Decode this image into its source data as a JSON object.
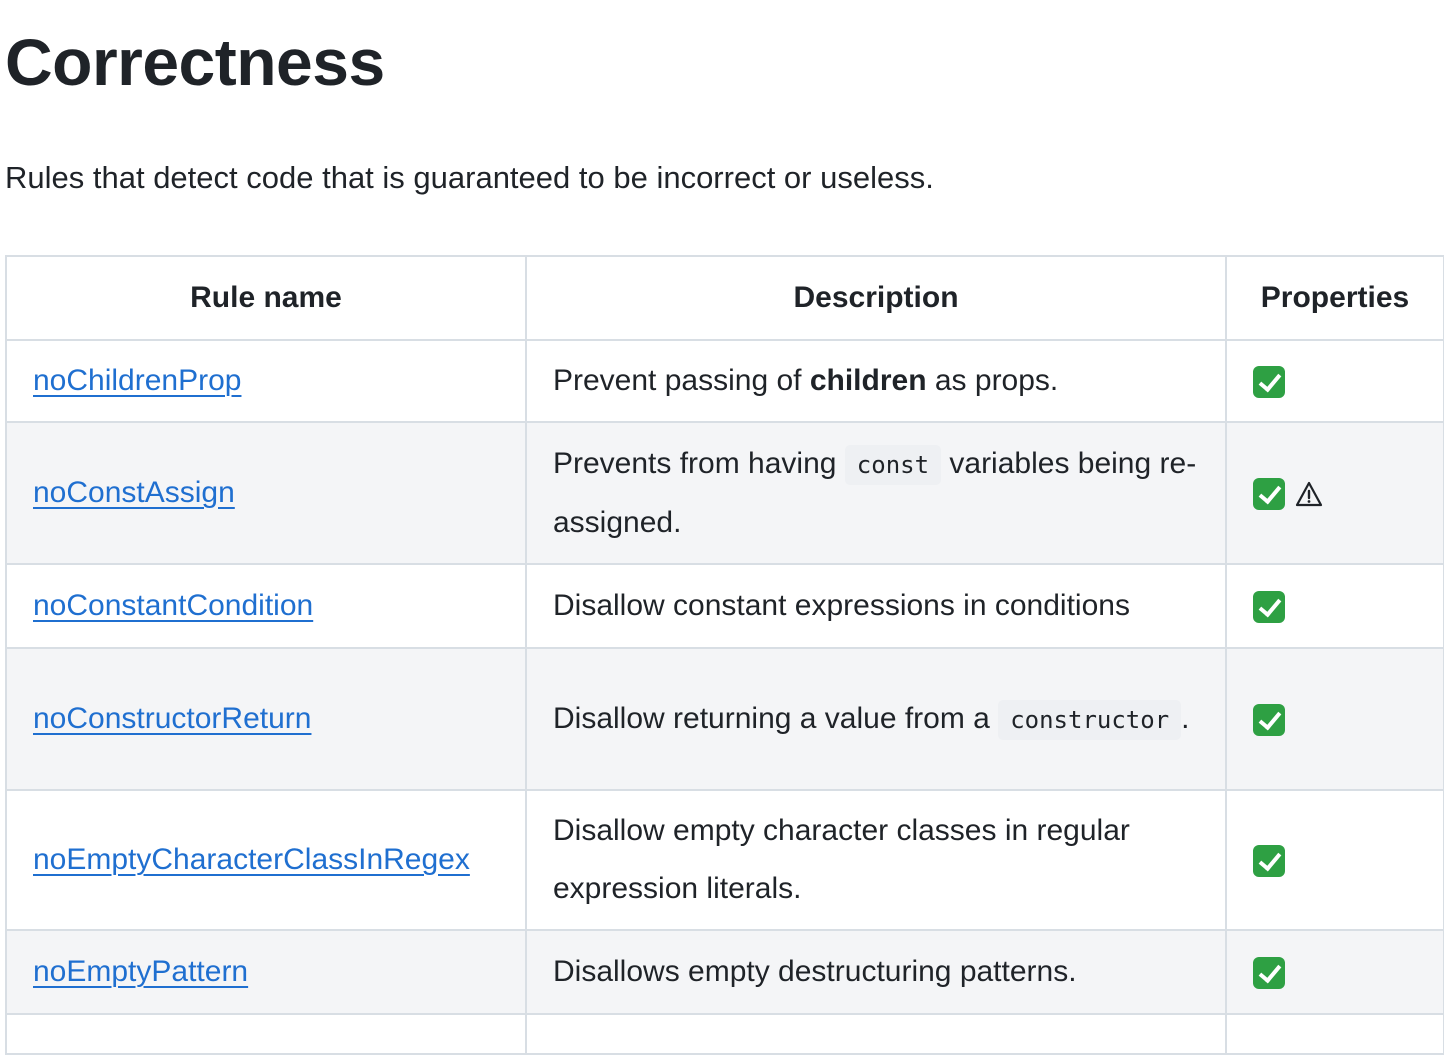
{
  "heading": "Correctness",
  "intro": "Rules that detect code that is guaranteed to be incorrect or useless.",
  "table": {
    "headers": [
      "Rule name",
      "Description",
      "Properties"
    ],
    "rows": [
      {
        "name": "noChildrenProp",
        "desc_before": "Prevent passing of ",
        "desc_bold": "children",
        "desc_after": " as props.",
        "props": [
          "recommended-icon"
        ]
      },
      {
        "name": "noConstAssign",
        "desc_before": "Prevents from having ",
        "desc_code": "const",
        "desc_after": " variables being re-assigned.",
        "props": [
          "recommended-icon",
          "warning-icon"
        ]
      },
      {
        "name": "noConstantCondition",
        "desc": "Disallow constant expressions in conditions",
        "props": [
          "recommended-icon"
        ]
      },
      {
        "name": "noConstructorReturn",
        "desc_before": "Disallow returning a value from a ",
        "desc_code": "constructor",
        "desc_after": ".",
        "props": [
          "recommended-icon"
        ]
      },
      {
        "name": "noEmptyCharacterClassInRegex",
        "desc": "Disallow empty character classes in regular expression literals.",
        "props": [
          "recommended-icon"
        ]
      },
      {
        "name": "noEmptyPattern",
        "desc": "Disallows empty destructuring patterns.",
        "props": [
          "recommended-icon"
        ]
      }
    ]
  },
  "colors": {
    "link": "#1f6fd0",
    "border": "#d8dee4",
    "row_alt": "#f4f5f7",
    "check": "#2ea043"
  }
}
